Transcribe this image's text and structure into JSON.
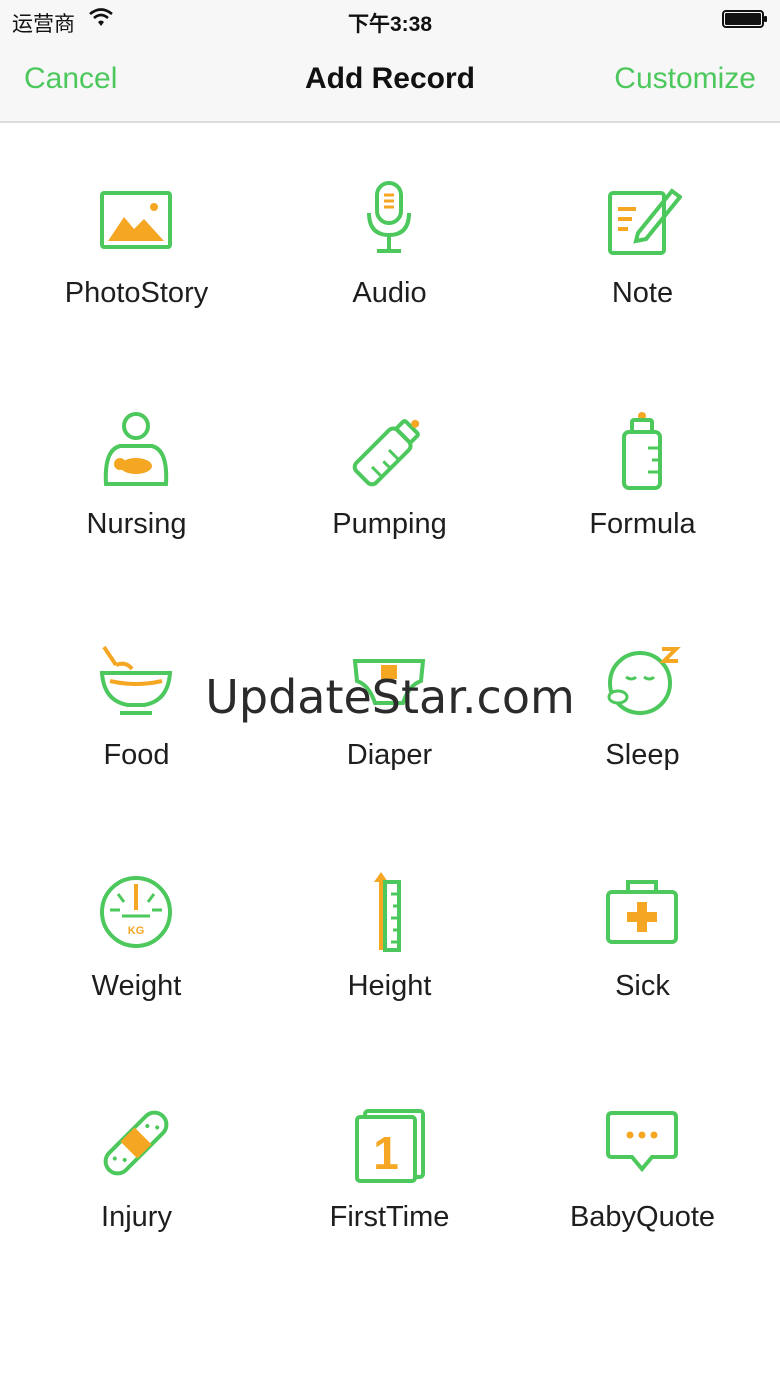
{
  "status_bar": {
    "carrier": "运营商",
    "time": "下午3:38"
  },
  "nav": {
    "cancel": "Cancel",
    "title": "Add Record",
    "customize": "Customize"
  },
  "colors": {
    "accent": "#4cc85c",
    "orange": "#f5a623"
  },
  "records": [
    {
      "label": "PhotoStory",
      "icon": "photo-icon"
    },
    {
      "label": "Audio",
      "icon": "microphone-icon"
    },
    {
      "label": "Note",
      "icon": "note-icon"
    },
    {
      "label": "Nursing",
      "icon": "nursing-icon"
    },
    {
      "label": "Pumping",
      "icon": "pump-bottle-icon"
    },
    {
      "label": "Formula",
      "icon": "formula-bottle-icon"
    },
    {
      "label": "Food",
      "icon": "bowl-icon"
    },
    {
      "label": "Diaper",
      "icon": "diaper-icon"
    },
    {
      "label": "Sleep",
      "icon": "sleep-icon"
    },
    {
      "label": "Weight",
      "icon": "scale-icon"
    },
    {
      "label": "Height",
      "icon": "ruler-icon"
    },
    {
      "label": "Sick",
      "icon": "first-aid-icon"
    },
    {
      "label": "Injury",
      "icon": "bandage-icon"
    },
    {
      "label": "FirstTime",
      "icon": "calendar-one-icon"
    },
    {
      "label": "BabyQuote",
      "icon": "speech-bubble-icon"
    }
  ],
  "watermark": "UpdateStar.com"
}
